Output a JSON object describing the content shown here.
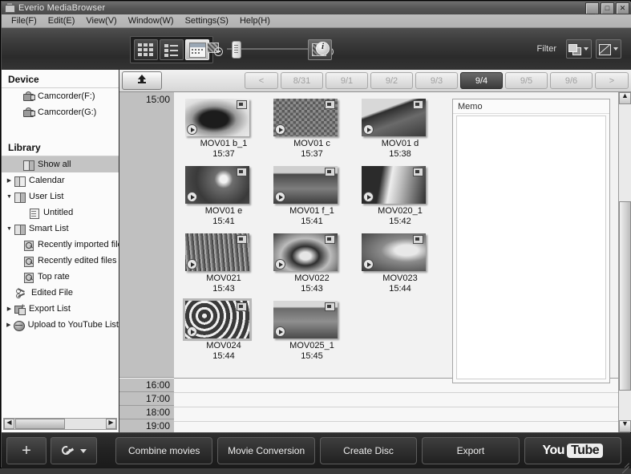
{
  "window": {
    "title": "Everio MediaBrowser",
    "icon": "camcorder-icon",
    "buttons": {
      "minimize": "_",
      "maximize": "□",
      "close": "✕"
    }
  },
  "menubar": {
    "items": [
      {
        "label": "File(F)"
      },
      {
        "label": "Edit(E)"
      },
      {
        "label": "View(V)"
      },
      {
        "label": "Window(W)"
      },
      {
        "label": "Settings(S)"
      },
      {
        "label": "Help(H)"
      }
    ]
  },
  "toolbar": {
    "view_buttons": [
      {
        "name": "grid-view-icon",
        "selected": false
      },
      {
        "name": "list-view-icon",
        "selected": false
      },
      {
        "name": "calendar-view-icon",
        "selected": true
      }
    ],
    "zoom_out_icon": "zoom-out-icon",
    "zoom_in_icon": "zoom-in-icon",
    "slider_value": "",
    "info_icon": "info-icon",
    "filter_label": "Filter",
    "filter_buttons": [
      {
        "name": "filter-media-type-icon"
      },
      {
        "name": "filter-rating-icon"
      }
    ]
  },
  "sidebar": {
    "sections": [
      {
        "heading": "Device",
        "items": [
          {
            "label": "Camcorder(F:)",
            "icon": "camcorder-icon",
            "indent": 1,
            "twisty": "",
            "selected": false
          },
          {
            "label": "Camcorder(G:)",
            "icon": "camcorder-icon",
            "indent": 1,
            "twisty": "",
            "selected": false
          }
        ]
      },
      {
        "heading": "Library",
        "items": [
          {
            "label": "Show all",
            "icon": "book-icon",
            "indent": 1,
            "twisty": "",
            "selected": true
          },
          {
            "label": "Calendar",
            "icon": "calendar-icon",
            "indent": 0,
            "twisty": "▶",
            "selected": false
          },
          {
            "label": "User List",
            "icon": "book-icon",
            "indent": 0,
            "twisty": "▼",
            "selected": false
          },
          {
            "label": "Untitled",
            "icon": "doc-icon",
            "indent": 2,
            "twisty": "",
            "selected": false
          },
          {
            "label": "Smart List",
            "icon": "book-icon",
            "indent": 0,
            "twisty": "▼",
            "selected": false
          },
          {
            "label": "Recently imported files",
            "icon": "smart-list-icon",
            "indent": 2,
            "twisty": "",
            "selected": false
          },
          {
            "label": "Recently edited files",
            "icon": "smart-list-icon",
            "indent": 2,
            "twisty": "",
            "selected": false
          },
          {
            "label": "Top rate",
            "icon": "smart-list-icon",
            "indent": 2,
            "twisty": "",
            "selected": false
          },
          {
            "label": "Edited File",
            "icon": "scissors-icon",
            "indent": 1,
            "twisty": "",
            "selected": false
          },
          {
            "label": "Export List",
            "icon": "export-icon",
            "indent": 0,
            "twisty": "▶",
            "selected": false
          },
          {
            "label": "Upload to YouTube List",
            "icon": "youtube-globe-icon",
            "indent": 0,
            "twisty": "▶",
            "selected": false
          }
        ]
      }
    ],
    "hscroll": {
      "left_arrow": "◀",
      "right_arrow": "▶"
    }
  },
  "datebar": {
    "up_button": "up-one-level-button",
    "prev": "<",
    "next": ">",
    "dates": [
      {
        "label": "8/31",
        "active": false
      },
      {
        "label": "9/1",
        "active": false
      },
      {
        "label": "9/2",
        "active": false
      },
      {
        "label": "9/3",
        "active": false
      },
      {
        "label": "9/4",
        "active": true
      },
      {
        "label": "9/5",
        "active": false
      },
      {
        "label": "9/6",
        "active": false
      }
    ]
  },
  "content": {
    "active_hour": "15:00",
    "hours": [
      "16:00",
      "17:00",
      "18:00",
      "19:00"
    ],
    "empty_rows": 4,
    "thumbnails": [
      {
        "name": "MOV01 b_1",
        "time": "15:37",
        "selected": false
      },
      {
        "name": "MOV01 c",
        "time": "15:37",
        "selected": false
      },
      {
        "name": "MOV01 d",
        "time": "15:38",
        "selected": false
      },
      {
        "name": "MOV01 e",
        "time": "15:41",
        "selected": false
      },
      {
        "name": "MOV01 f_1",
        "time": "15:41",
        "selected": false
      },
      {
        "name": "MOV020_1",
        "time": "15:42",
        "selected": false
      },
      {
        "name": "MOV021",
        "time": "15:43",
        "selected": false
      },
      {
        "name": "MOV022",
        "time": "15:43",
        "selected": false
      },
      {
        "name": "MOV023",
        "time": "15:44",
        "selected": false
      },
      {
        "name": "MOV024",
        "time": "15:44",
        "selected": true
      },
      {
        "name": "MOV025_1",
        "time": "15:45",
        "selected": false
      }
    ],
    "memo": {
      "title": "Memo",
      "value": ""
    }
  },
  "vscroll": {
    "up_arrow": "▲",
    "down_arrow": "▼"
  },
  "bottombar": {
    "add_label": "+",
    "tools_icon": "wrench-icon",
    "buttons": [
      {
        "label": "Combine movies"
      },
      {
        "label": "Movie Conversion"
      },
      {
        "label": "Create Disc"
      },
      {
        "label": "Export"
      }
    ],
    "youtube": {
      "you": "You",
      "tube": "Tube"
    }
  },
  "colors": {
    "accent": "#3a3a3a",
    "selection": "#c4c4c4",
    "sidebar_bg": "#fbfbfb",
    "content_bg": "#f2f2f2",
    "hour_col": "#c0c0c0"
  }
}
